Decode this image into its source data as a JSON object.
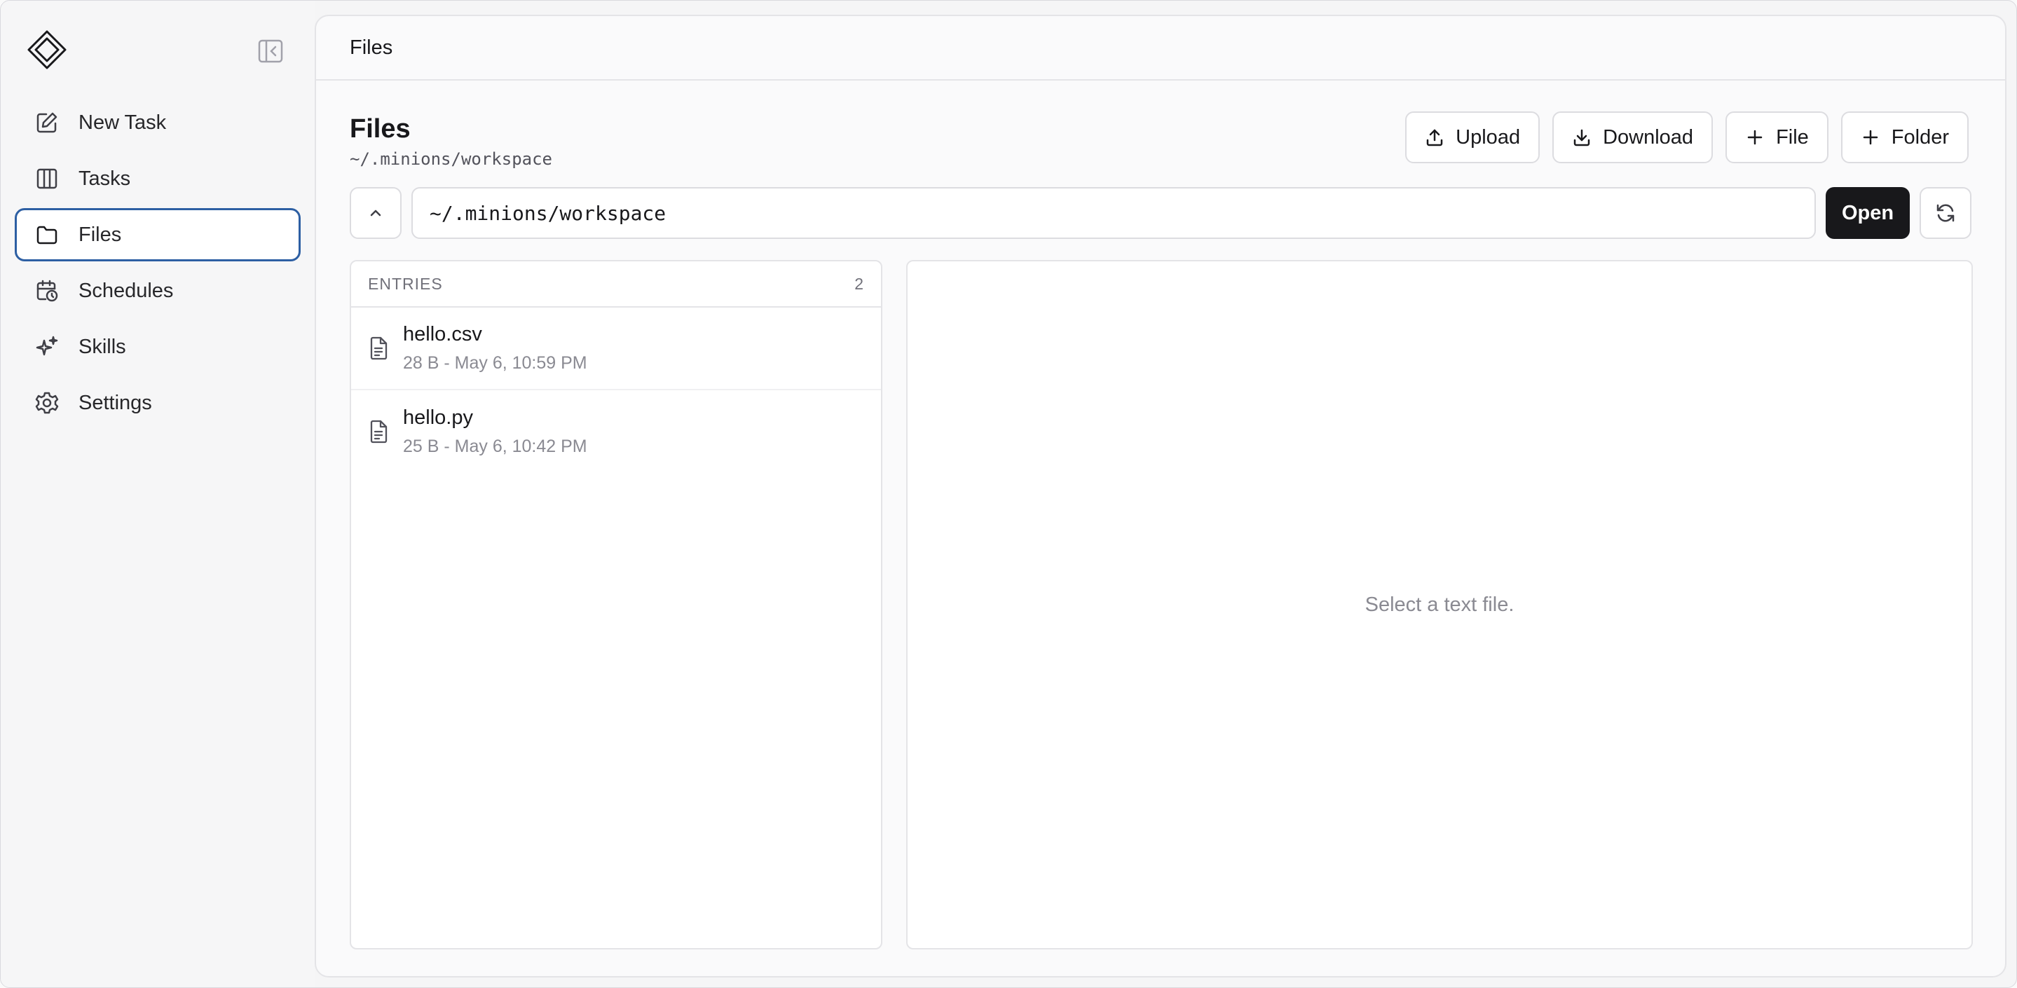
{
  "sidebar": {
    "logo_icon": "diamond-logo-icon",
    "collapse_icon": "sidebar-collapse-icon",
    "items": [
      {
        "label": "New Task",
        "icon": "pencil-square-icon",
        "active": false
      },
      {
        "label": "Tasks",
        "icon": "columns-icon",
        "active": false
      },
      {
        "label": "Files",
        "icon": "folder-icon",
        "active": true
      },
      {
        "label": "Schedules",
        "icon": "calendar-clock-icon",
        "active": false
      },
      {
        "label": "Skills",
        "icon": "sparkles-icon",
        "active": false
      },
      {
        "label": "Settings",
        "icon": "gear-icon",
        "active": false
      }
    ],
    "active_border_color": "#2d5fa3"
  },
  "topbar": {
    "title": "Files"
  },
  "page": {
    "title": "Files",
    "subtitle": "~/.minions/workspace"
  },
  "actions": {
    "upload": "Upload",
    "download": "Download",
    "new_file": "File",
    "new_folder": "Folder"
  },
  "path_bar": {
    "value": "~/.minions/workspace",
    "open_label": "Open"
  },
  "entries": {
    "header": "ENTRIES",
    "count": "2",
    "items": [
      {
        "name": "hello.csv",
        "meta": "28 B - May 6, 10:59 PM",
        "icon": "file-text-icon"
      },
      {
        "name": "hello.py",
        "meta": "25 B - May 6, 10:42 PM",
        "icon": "file-text-icon"
      }
    ]
  },
  "preview": {
    "empty_text": "Select a text file."
  },
  "colors": {
    "primary_button": "#18181b",
    "muted_text": "#8a8a92"
  }
}
